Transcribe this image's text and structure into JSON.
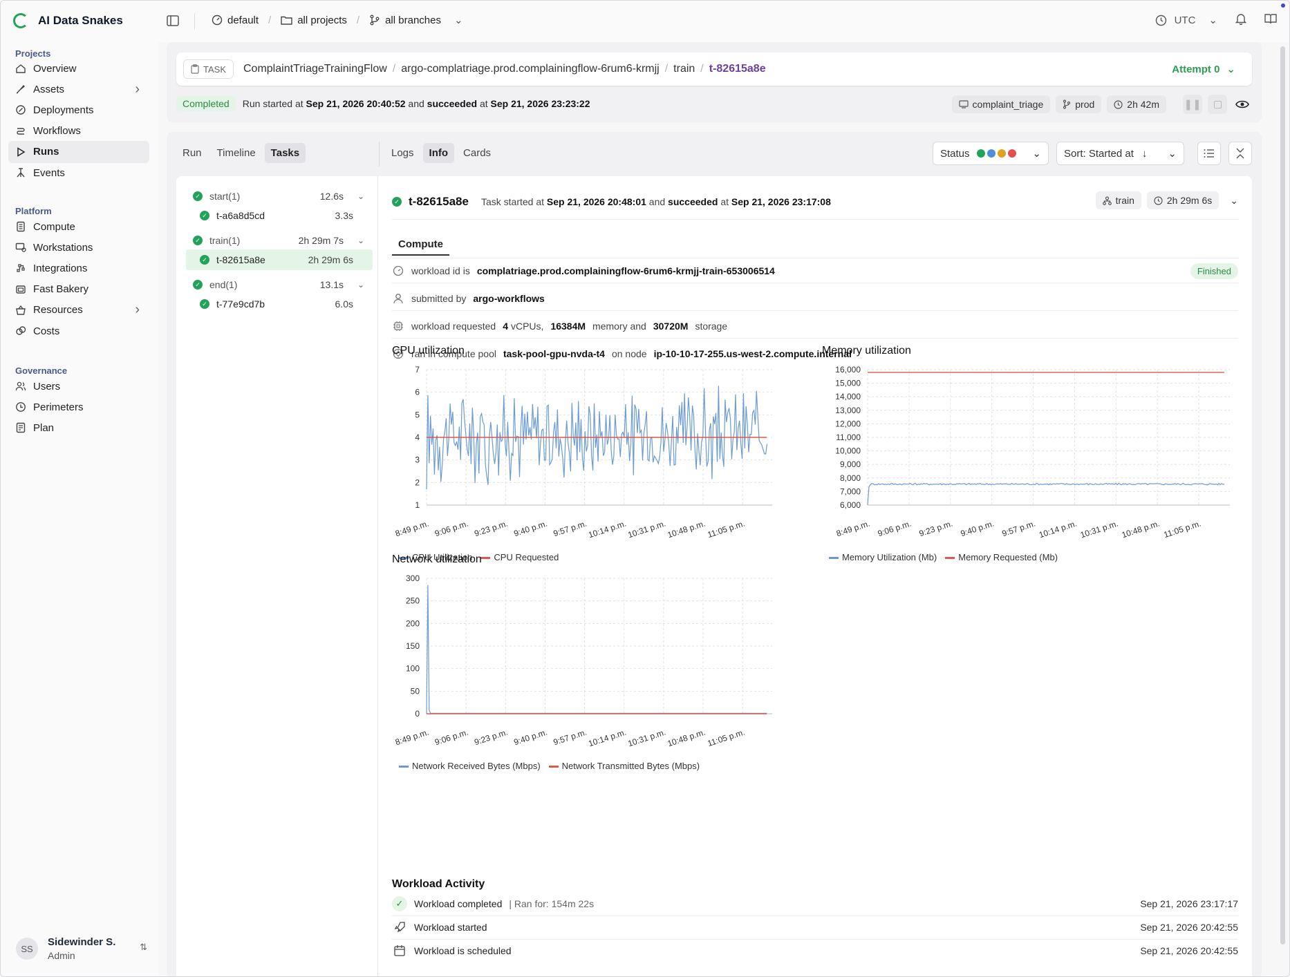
{
  "app": {
    "name": "AI Data Snakes"
  },
  "topbar": {
    "project_scope": "default",
    "projects": "all projects",
    "branches": "all branches",
    "timezone": "UTC"
  },
  "sidebar": {
    "sections": [
      {
        "title": "Projects",
        "items": [
          {
            "label": "Overview",
            "icon": "home-icon"
          },
          {
            "label": "Assets",
            "icon": "assets-icon",
            "chevron": true
          },
          {
            "label": "Deployments",
            "icon": "deployments-icon"
          },
          {
            "label": "Workflows",
            "icon": "workflows-icon"
          },
          {
            "label": "Runs",
            "icon": "runs-icon",
            "active": true
          },
          {
            "label": "Events",
            "icon": "events-icon"
          }
        ]
      },
      {
        "title": "Platform",
        "items": [
          {
            "label": "Compute",
            "icon": "compute-icon"
          },
          {
            "label": "Workstations",
            "icon": "workstations-icon"
          },
          {
            "label": "Integrations",
            "icon": "integrations-icon"
          },
          {
            "label": "Fast Bakery",
            "icon": "bakery-icon"
          },
          {
            "label": "Resources",
            "icon": "resources-icon",
            "chevron": true
          },
          {
            "label": "Costs",
            "icon": "costs-icon"
          }
        ]
      },
      {
        "title": "Governance",
        "items": [
          {
            "label": "Users",
            "icon": "users-icon"
          },
          {
            "label": "Perimeters",
            "icon": "perimeters-icon"
          },
          {
            "label": "Plan",
            "icon": "plan-icon"
          }
        ]
      }
    ],
    "user": {
      "initials": "SS",
      "name": "Sidewinder S.",
      "role": "Admin"
    }
  },
  "header": {
    "tag": "TASK",
    "path": [
      "ComplaintTriageTrainingFlow",
      "argo-complatriage.prod.complainingflow-6rum6-krmjj",
      "train"
    ],
    "current": "t-82615a8e",
    "attempt": "Attempt 0",
    "status": "Completed",
    "run_text_1": "Run started at",
    "run_started": "Sep 21, 2026 20:40:52",
    "run_text_2": "and",
    "run_succeeded_word": "succeeded",
    "run_text_3": "at",
    "run_ended": "Sep 21, 2026 23:23:22",
    "pills": {
      "project": "complaint_triage",
      "branch": "prod",
      "duration": "2h 42m"
    }
  },
  "tabs": {
    "left": [
      "Run",
      "Timeline",
      "Tasks"
    ],
    "left_active": "Tasks",
    "right": [
      "Logs",
      "Info",
      "Cards"
    ],
    "right_active": "Info",
    "status_filter": "Status",
    "sort": "Sort: Started at",
    "status_colors": [
      "#22a35a",
      "#4a8fd8",
      "#e0a020",
      "#e05050"
    ]
  },
  "tree": [
    {
      "name": "start(1)",
      "dur": "12.6s",
      "level": 0
    },
    {
      "name": "t-a6a8d5cd",
      "dur": "3.3s",
      "level": 1
    },
    {
      "name": "train(1)",
      "dur": "2h 29m 7s",
      "level": 0
    },
    {
      "name": "t-82615a8e",
      "dur": "2h 29m 6s",
      "level": 1,
      "selected": true
    },
    {
      "name": "end(1)",
      "dur": "13.1s",
      "level": 0
    },
    {
      "name": "t-77e9cd7b",
      "dur": "6.0s",
      "level": 1
    }
  ],
  "task": {
    "name": "t-82615a8e",
    "t1": "Task started at",
    "started": "Sep 21, 2026 20:48:01",
    "t2": "and",
    "succeeded_word": "succeeded",
    "t3": "at",
    "ended": "Sep 21, 2026 23:17:08",
    "step": "train",
    "duration": "2h 29m 6s",
    "subtab": "Compute"
  },
  "compute": {
    "workload_id_label": "workload id is",
    "workload_id": "complatriage.prod.complainingflow-6rum6-krmjj-train-653006514",
    "workload_status": "Finished",
    "submitted_label": "submitted by",
    "submitted_by": "argo-workflows",
    "req_label": "workload requested",
    "req_cpus": "4",
    "req_cpus_unit": "vCPUs,",
    "req_mem": "16384M",
    "req_mem_unit": "memory and",
    "req_storage": "30720M",
    "req_storage_unit": "storage",
    "pool_label": "ran in compute pool",
    "pool": "task-pool-gpu-nvda-t4",
    "node_label": "on node",
    "node": "ip-10-10-17-255.us-west-2.compute.internal"
  },
  "chart_data": [
    {
      "type": "line",
      "title": "CPU utilization",
      "x_ticks": [
        "8:49 p.m.",
        "9:06 p.m.",
        "9:23 p.m.",
        "9:40 p.m.",
        "9:57 p.m.",
        "10:14 p.m.",
        "10:31 p.m.",
        "10:48 p.m.",
        "11:05 p.m."
      ],
      "y_ticks": [
        "1",
        "2",
        "3",
        "4",
        "5",
        "6",
        "7"
      ],
      "ylim": [
        1,
        7
      ],
      "grid": true,
      "legend": "bottom-left",
      "series": [
        {
          "name": "CPU Utilization",
          "color": "#6b9bd2",
          "pattern": "noisy",
          "base": 4.1,
          "amplitude": 2.4,
          "start": 1.0
        },
        {
          "name": "CPU Requested",
          "color": "#e0574f",
          "constant": 4
        }
      ]
    },
    {
      "type": "line",
      "title": "Memory utilization",
      "x_ticks": [
        "8:49 p.m.",
        "9:06 p.m.",
        "9:23 p.m.",
        "9:40 p.m.",
        "9:57 p.m.",
        "10:14 p.m.",
        "10:31 p.m.",
        "10:48 p.m.",
        "11:05 p.m."
      ],
      "y_ticks": [
        "6,000",
        "7,000",
        "8,000",
        "9,000",
        "10,000",
        "11,000",
        "12,000",
        "13,000",
        "14,000",
        "15,000",
        "16,000"
      ],
      "ylim": [
        6000,
        16000
      ],
      "grid": true,
      "legend": "bottom-left",
      "series": [
        {
          "name": "Memory Utilization (Mb)",
          "color": "#6b9bd2",
          "pattern": "flat",
          "base": 7550,
          "amplitude": 120,
          "start": 6000
        },
        {
          "name": "Memory Requested (Mb)",
          "color": "#e0574f",
          "constant": 15800
        }
      ]
    },
    {
      "type": "line",
      "title": "Network utilization",
      "x_ticks": [
        "8:49 p.m.",
        "9:06 p.m.",
        "9:23 p.m.",
        "9:40 p.m.",
        "9:57 p.m.",
        "10:14 p.m.",
        "10:31 p.m.",
        "10:48 p.m.",
        "11:05 p.m."
      ],
      "y_ticks": [
        "0",
        "50",
        "100",
        "150",
        "200",
        "250",
        "300"
      ],
      "ylim": [
        0,
        300
      ],
      "grid": true,
      "legend": "bottom-left",
      "series": [
        {
          "name": "Network Received Bytes (Mbps)",
          "color": "#6b9bd2",
          "pattern": "spike",
          "base": 0,
          "peak": 285
        },
        {
          "name": "Network Transmitted Bytes (Mbps)",
          "color": "#e0574f",
          "constant": 0
        }
      ]
    }
  ],
  "activity": {
    "title": "Workload Activity",
    "rows": [
      {
        "label": "Workload completed",
        "extra": "| Ran for: 154m 22s",
        "time": "Sep 21, 2026 23:17:17",
        "icon": "check-icon"
      },
      {
        "label": "Workload started",
        "extra": "",
        "time": "Sep 21, 2026 20:42:55",
        "icon": "rocket-icon"
      },
      {
        "label": "Workload is scheduled",
        "extra": "",
        "time": "Sep 21, 2026 20:42:55",
        "icon": "calendar-icon"
      }
    ]
  }
}
